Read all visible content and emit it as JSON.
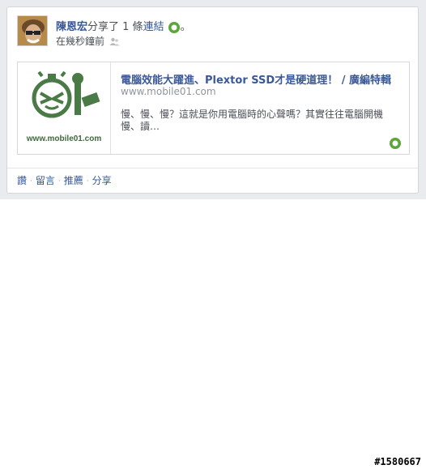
{
  "post": {
    "user_name": "陳恩宏",
    "action_prefix": "分享了 1 條",
    "link_word": "連結",
    "period": "。",
    "time": "在幾秒鐘前",
    "icons": {
      "friends": "friends-audience-icon",
      "share_source": "green-circle-icon"
    }
  },
  "link_preview": {
    "thumb_domain": "www.mobile01.com",
    "title": "電腦效能大躍進、Plextor SSD才是硬道理！ / 廣編特輯",
    "domain": "www.mobile01.com",
    "description": "慢、慢、慢？這就是你用電腦時的心聲嗎？其實往往電腦開機慢、讀…",
    "colors": {
      "logo_green": "#4a7a45"
    }
  },
  "actions": {
    "like": "讚",
    "comment": "留言",
    "recommend": "推薦",
    "share": "分享",
    "separator": "·"
  },
  "watermark": "#1580667"
}
